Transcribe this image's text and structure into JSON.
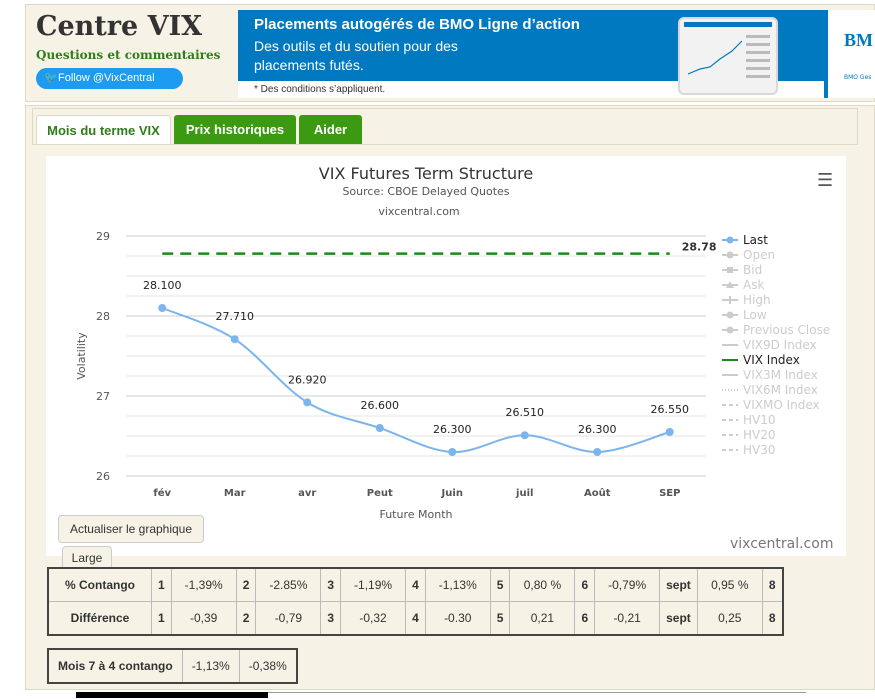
{
  "header": {
    "title": "Centre VIX",
    "comments_link": "Questions et commentaires",
    "follow_button": "Follow @VixCentral"
  },
  "ad": {
    "headline": "Placements autogérés de BMO Ligne d’action",
    "subtext": "Des outils et du soutien pour des placements futés.",
    "disclaimer": "* Des conditions s’appliquent.",
    "brand": "BM",
    "brand_small": "BMO Ges"
  },
  "tabs": [
    {
      "label": "Mois du terme VIX",
      "active": true
    },
    {
      "label": "Prix historiques",
      "active": false
    },
    {
      "label": "Aider",
      "active": false
    }
  ],
  "chart_data": {
    "type": "line",
    "title": "VIX Futures Term Structure",
    "subtitle": "Source: CBOE Delayed Quotes",
    "credit_top": "vixcentral.com",
    "credit_bottom": "vixcentral.com",
    "xlabel": "Future Month",
    "ylabel": "Volatility",
    "categories": [
      "fév",
      "Mar",
      "avr",
      "Peut",
      "Juin",
      "juil",
      "Août",
      "SEP"
    ],
    "ylim": [
      26,
      29
    ],
    "yticks": [
      "26",
      "27",
      "28",
      "29"
    ],
    "grid": true,
    "legend_position": "right",
    "series": [
      {
        "name": "Last",
        "color": "#7cb5ec",
        "values": [
          28.1,
          27.71,
          26.92,
          26.6,
          26.3,
          26.51,
          26.3,
          26.55
        ],
        "labels": [
          "28.100",
          "27.710",
          "26.920",
          "26.600",
          "26.300",
          "26.510",
          "26.300",
          "26.550"
        ]
      },
      {
        "name": "VIX Index",
        "color": "#1a8a1a",
        "style": "dashed",
        "value": 28.78,
        "label": "28.78"
      }
    ],
    "legend": [
      {
        "name": "Last",
        "active": true,
        "marker": "circle"
      },
      {
        "name": "Open",
        "active": false,
        "marker": "circle"
      },
      {
        "name": "Bid",
        "active": false,
        "marker": "square"
      },
      {
        "name": "Ask",
        "active": false,
        "marker": "triangle"
      },
      {
        "name": "High",
        "active": false,
        "marker": "cross"
      },
      {
        "name": "Low",
        "active": false,
        "marker": "circle"
      },
      {
        "name": "Previous Close",
        "active": false,
        "marker": "circle"
      },
      {
        "name": "VIX9D Index",
        "active": false,
        "marker": "line"
      },
      {
        "name": "VIX Index",
        "active": true,
        "marker": "dash"
      },
      {
        "name": "VIX3M Index",
        "active": false,
        "marker": "line"
      },
      {
        "name": "VIX6M Index",
        "active": false,
        "marker": "dots"
      },
      {
        "name": "VIXMO Index",
        "active": false,
        "marker": "dashdot"
      },
      {
        "name": "HV10",
        "active": false,
        "marker": "dashdot"
      },
      {
        "name": "HV20",
        "active": false,
        "marker": "dashdot"
      },
      {
        "name": "HV30",
        "active": false,
        "marker": "dashdot"
      }
    ]
  },
  "buttons": {
    "refresh": "Actualiser le graphique",
    "large": "Large"
  },
  "contango_table": {
    "rows": [
      {
        "label": "% Contango",
        "cells": [
          "1",
          "-1,39%",
          "2",
          "-2.85%",
          "3",
          "-1,19%",
          "4",
          "-1,13%",
          "5",
          "0,80 %",
          "6",
          "-0,79%",
          "sept",
          "0,95 %",
          "8"
        ]
      },
      {
        "label": "Différence",
        "cells": [
          "1",
          "-0,39",
          "2",
          "-0,79",
          "3",
          "-0,32",
          "4",
          "-0.30",
          "5",
          "0,21",
          "6",
          "-0,21",
          "sept",
          "0,25",
          "8"
        ]
      }
    ]
  },
  "month74_table": {
    "label": "Mois 7 à 4 contango",
    "values": [
      "-1,13%",
      "-0,38%"
    ]
  }
}
